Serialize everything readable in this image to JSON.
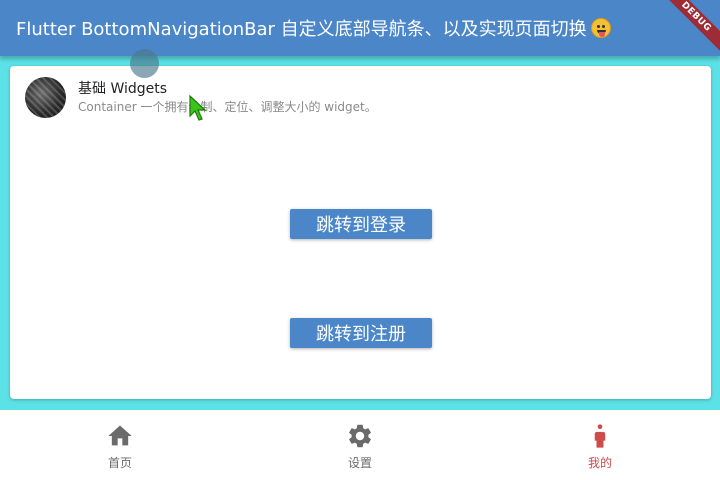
{
  "appbar": {
    "title": "Flutter BottomNavigationBar 自定义底部导航条、以及实现页面切换",
    "emoji": "face-with-tongue-icon",
    "debug_banner": "DEBUG"
  },
  "list_tile": {
    "title": "基础 Widgets",
    "subtitle": "Container 一个拥有绘制、定位、调整大小的 widget。"
  },
  "buttons": {
    "login_label": "跳转到登录",
    "register_label": "跳转到注册"
  },
  "bottom_nav": {
    "items": [
      {
        "label": "首页",
        "icon": "home-icon"
      },
      {
        "label": "设置",
        "icon": "settings-icon"
      },
      {
        "label": "我的",
        "icon": "person-icon"
      }
    ],
    "active_index": 2
  },
  "colors": {
    "primary": "#4a86c8",
    "background": "#5ce1e6",
    "active_nav": "#cc4b4b",
    "inactive_nav": "#6b6b6b"
  }
}
